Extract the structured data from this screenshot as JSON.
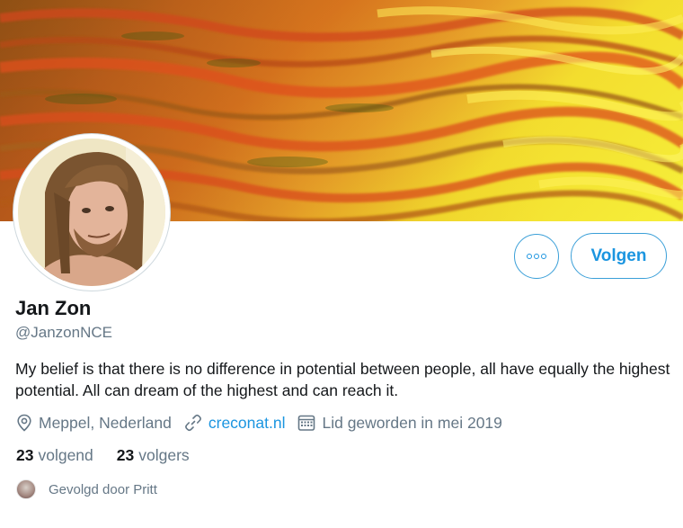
{
  "profile": {
    "name": "Jan Zon",
    "handle": "@JanzonNCE",
    "bio": "My belief is that there is no difference in potential between people, all have equally the highest potential. All can dream of the highest and can reach it.",
    "location": "Meppel, Nederland",
    "website": "creconat.nl",
    "joined": "Lid geworden in mei 2019"
  },
  "actions": {
    "more_icon": "more-horizontal-icon",
    "follow_label": "Volgen"
  },
  "stats": {
    "following_count": "23",
    "following_label": "volgend",
    "followers_count": "23",
    "followers_label": "volgers"
  },
  "followed_by": {
    "text": "Gevolgd door Pritt"
  },
  "colors": {
    "accent": "#1b95e0",
    "secondary_text": "#657786",
    "primary_text": "#14171a"
  }
}
